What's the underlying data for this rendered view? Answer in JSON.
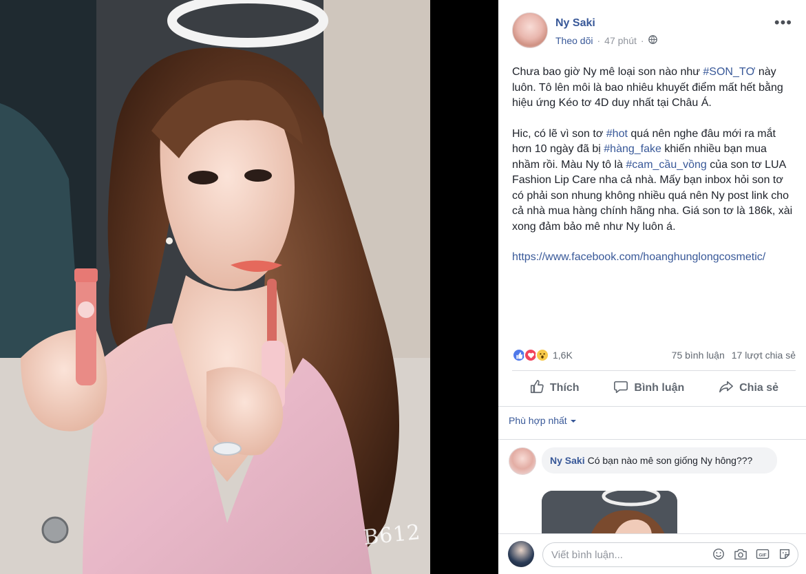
{
  "photo": {
    "watermark": "B612"
  },
  "post": {
    "author": "Ny Saki",
    "follow_label": "Theo dõi",
    "time": "47 phút",
    "dot": "·",
    "more": "•••",
    "paragraph1": {
      "t1": "Chưa bao giờ Ny mê loại son nào như ",
      "tag1": "#SON_TƠ",
      "t2": " này luôn. Tô lên môi là bao nhiêu khuyết điểm mất hết bằng hiệu ứng Kéo tơ 4D duy nhất tại Châu Á."
    },
    "paragraph2": {
      "t1": "Hic, có lẽ vì son tơ ",
      "tag1": "#hot",
      "t2": " quá nên nghe đâu mới ra mắt hơn 10 ngày đã bị ",
      "tag2": "#hàng_fake",
      "t3": " khiến nhiều bạn mua nhầm rồi. Màu Ny tô là ",
      "tag3": "#cam_cầu_vồng",
      "t4": " của son tơ LUA Fashion Lip Care nha cả nhà. Mấy bạn inbox hỏi son tơ có phải son nhung không nhiều quá nên Ny post link cho cả nhà mua hàng chính hãng nha. Giá son tơ là 186k, xài xong đảm bảo mê như Ny luôn á."
    },
    "link": "https://www.facebook.com/hoanghunglongcosmetic/"
  },
  "reactions": {
    "count": "1,6K",
    "comments": "75 bình luận",
    "shares": "17 lượt chia sẻ"
  },
  "actions": {
    "like": "Thích",
    "comment": "Bình luận",
    "share": "Chia sẻ"
  },
  "comments": {
    "sort_label": "Phù hợp nhất",
    "items": [
      {
        "author": "Ny Saki",
        "text": "Có bạn nào mê son giống Ny hông???"
      }
    ]
  },
  "composer": {
    "placeholder": "Viết bình luận..."
  },
  "colors": {
    "link": "#385898",
    "like": "#4f79ea",
    "love": "#f1445c",
    "wow": "#f7c94a"
  }
}
